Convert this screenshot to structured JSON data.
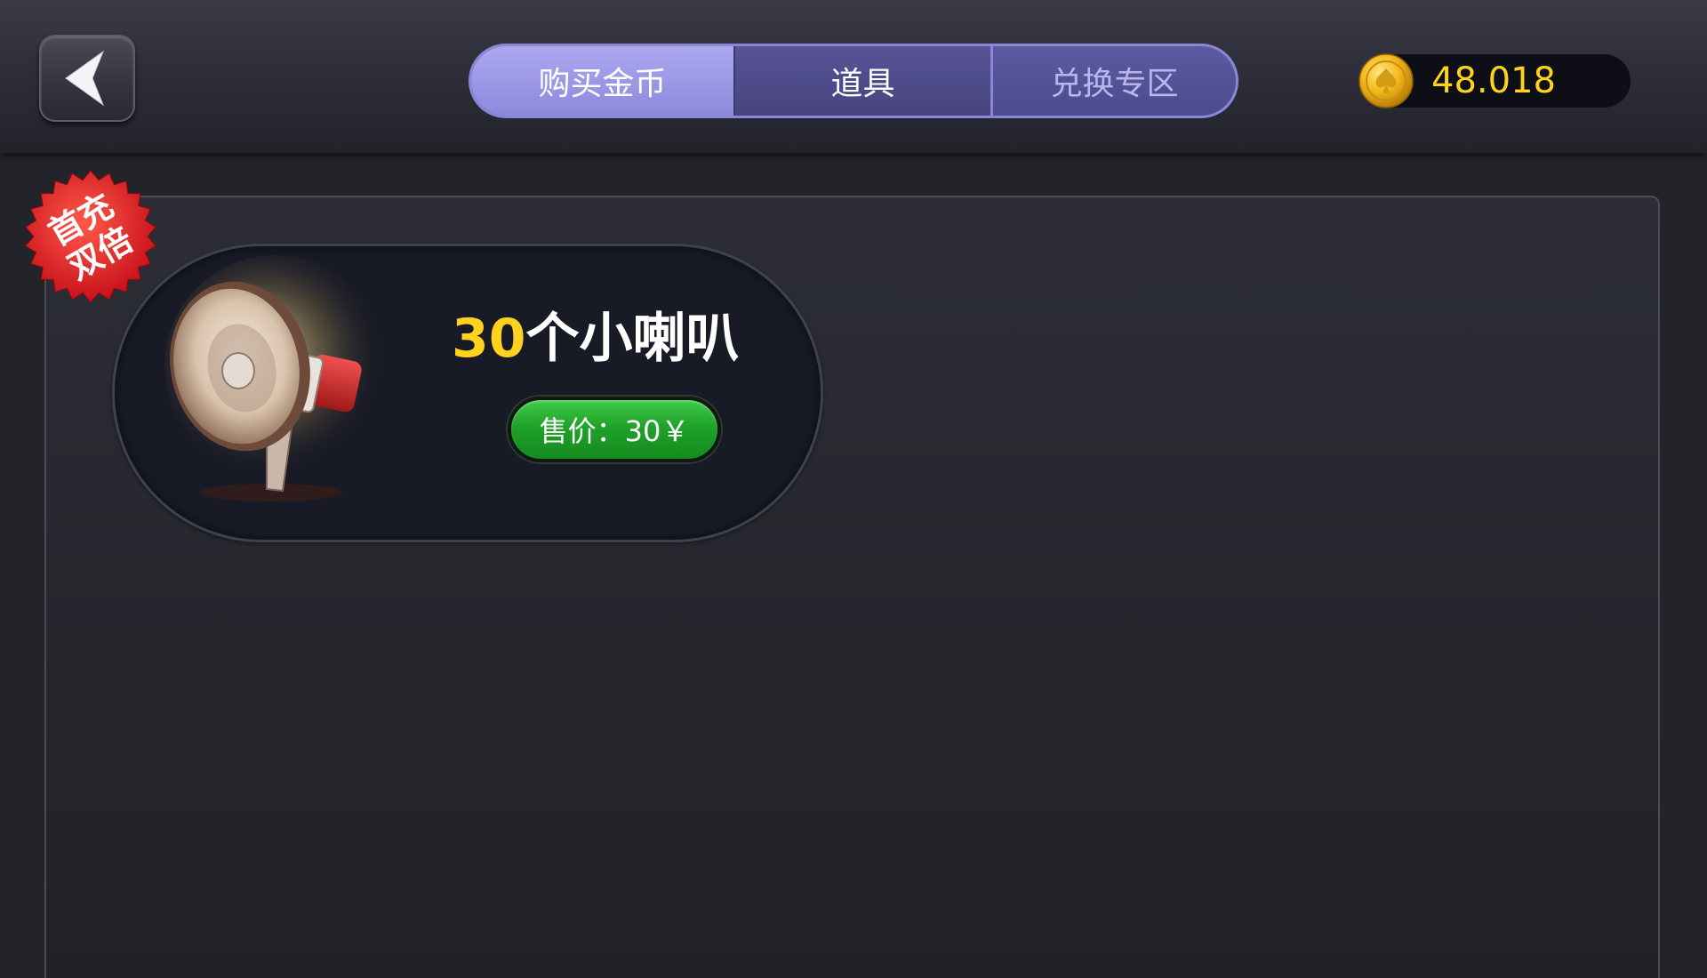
{
  "header": {
    "tabs": [
      {
        "label": "购买金币",
        "active": false
      },
      {
        "label": "道具",
        "active": true
      },
      {
        "label": "兑换专区",
        "active": false
      }
    ],
    "balance": "48.018"
  },
  "item": {
    "quantity": "30",
    "name": "个小喇叭",
    "price_button": "售价：30￥",
    "badge_line1": "首充",
    "badge_line2": "双倍",
    "icon": "megaphone-icon"
  },
  "colors": {
    "accent_gold": "#ffd21f",
    "tab_active": "#8d89dd",
    "buy_green": "#1fa22a",
    "badge_red": "#e02020"
  }
}
